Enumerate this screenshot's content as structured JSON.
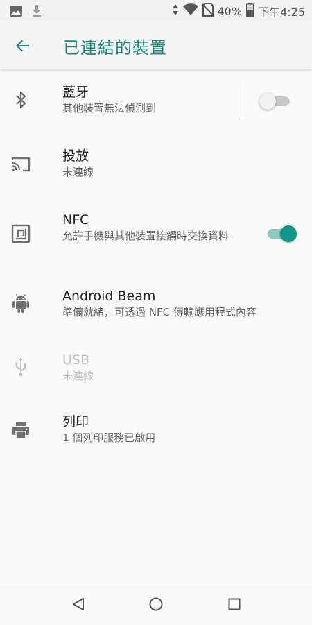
{
  "status_bar": {
    "battery_percent": "40%",
    "time": "下午4:25",
    "icons": [
      "image-icon",
      "download-icon",
      "data-arrows-icon",
      "wifi-icon",
      "no-sim-icon",
      "battery-icon"
    ]
  },
  "app_bar": {
    "title": "已連結的裝置",
    "back_icon": "arrow-back-icon",
    "accent_color": "#138a7c"
  },
  "items": [
    {
      "icon": "bluetooth-icon",
      "title": "藍牙",
      "subtitle": "其他裝置無法偵測到",
      "switch": "off",
      "enabled": true
    },
    {
      "icon": "cast-icon",
      "title": "投放",
      "subtitle": "未連線",
      "enabled": true
    },
    {
      "icon": "nfc-icon",
      "title": "NFC",
      "subtitle": "允許手機與其他裝置接觸時交換資料",
      "switch": "on",
      "enabled": true
    },
    {
      "icon": "android-icon",
      "title": "Android Beam",
      "subtitle": "準備就緒，可透過 NFC 傳輸應用程式內容",
      "enabled": true
    },
    {
      "icon": "usb-icon",
      "title": "USB",
      "subtitle": "未連線",
      "enabled": false
    },
    {
      "icon": "print-icon",
      "title": "列印",
      "subtitle": "1 個列印服務已啟用",
      "enabled": true
    }
  ],
  "nav_bar": {
    "buttons": [
      "back-triangle-icon",
      "home-circle-icon",
      "recents-square-icon"
    ]
  }
}
